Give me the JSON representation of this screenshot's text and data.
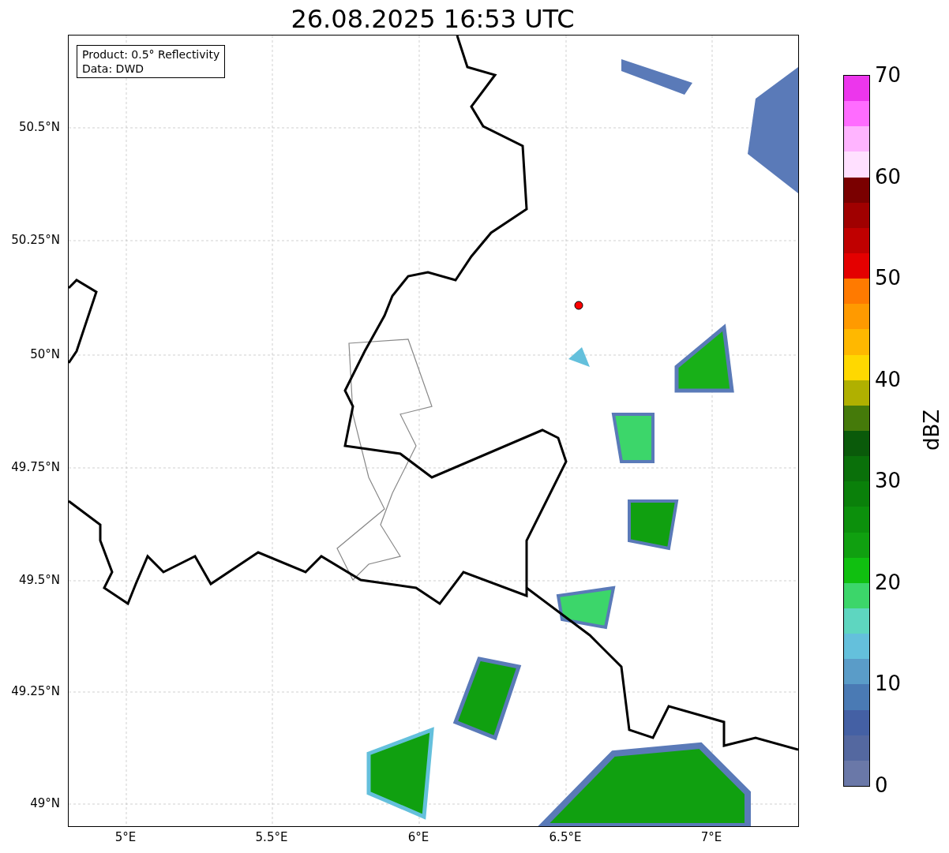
{
  "title": "26.08.2025 16:53 UTC",
  "info_box": [
    "Product: 0.5° Reflectivity",
    "Data: DWD"
  ],
  "y_ticks": [
    "50.5°N",
    "50.25°N",
    "50°N",
    "49.75°N",
    "49.5°N",
    "49.25°N",
    "49°N"
  ],
  "x_ticks": [
    "5°E",
    "5.5°E",
    "6°E",
    "6.5°E",
    "7°E"
  ],
  "colorbar": {
    "label": "dBZ",
    "ticks": [
      "70",
      "60",
      "50",
      "40",
      "30",
      "20",
      "10",
      "0"
    ],
    "segments": [
      {
        "color": "#ec36ec"
      },
      {
        "color": "#ff6cff"
      },
      {
        "color": "#ffb4ff"
      },
      {
        "color": "#ffe0ff"
      },
      {
        "color": "#7a0000"
      },
      {
        "color": "#a00000"
      },
      {
        "color": "#c00000"
      },
      {
        "color": "#e40000"
      },
      {
        "color": "#ff7a00"
      },
      {
        "color": "#ff9a00"
      },
      {
        "color": "#ffb800"
      },
      {
        "color": "#ffd800"
      },
      {
        "color": "#b0b000"
      },
      {
        "color": "#457a0a"
      },
      {
        "color": "#0a5a0a"
      },
      {
        "color": "#0a700a"
      },
      {
        "color": "#0a800a"
      },
      {
        "color": "#0c900c"
      },
      {
        "color": "#10a010"
      },
      {
        "color": "#10c010"
      },
      {
        "color": "#3cd66a"
      },
      {
        "color": "#5ed6c0"
      },
      {
        "color": "#64c0dc"
      },
      {
        "color": "#5a9cc8"
      },
      {
        "color": "#4a7ab4"
      },
      {
        "color": "#4460a4"
      },
      {
        "color": "#5468a0"
      },
      {
        "color": "#6a78a8"
      }
    ]
  }
}
